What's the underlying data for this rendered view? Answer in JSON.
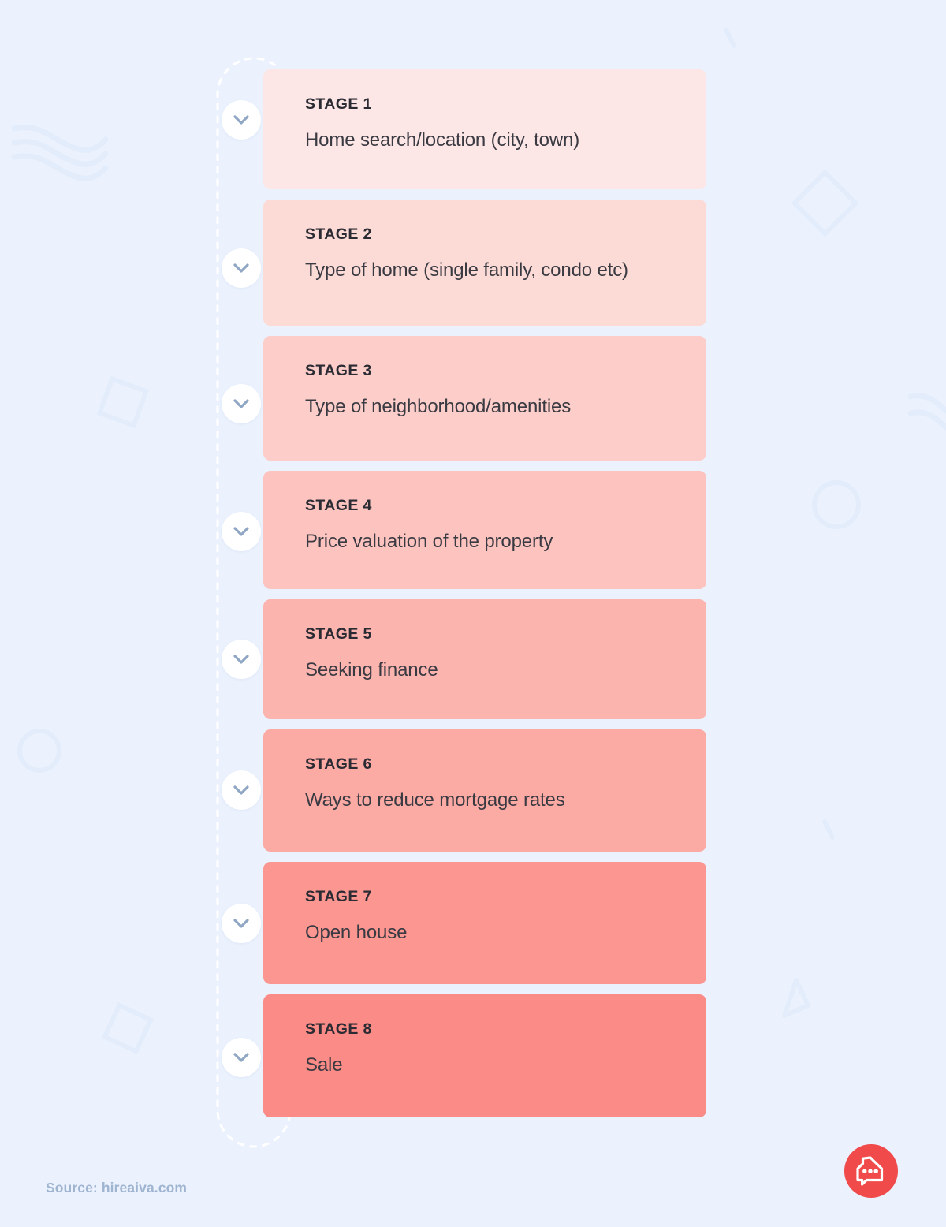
{
  "background": {
    "color": "#EBF2FE",
    "decor_color": "#E2EBFA"
  },
  "stages": [
    {
      "label": "STAGE 1",
      "text": "Home search/location (city, town)",
      "color": "#FDE6E6",
      "chevron_icon": "chevron-down-icon"
    },
    {
      "label": "STAGE 2",
      "text": "Type of home (single family, condo etc)",
      "color": "#FCDAD6",
      "chevron_icon": "chevron-down-icon"
    },
    {
      "label": "STAGE 3",
      "text": "Type of neighborhood/amenities",
      "color": "#FCCDC9",
      "chevron_icon": "chevron-down-icon"
    },
    {
      "label": "STAGE 4",
      "text": "Price valuation of the property",
      "color": "#FCC3BF",
      "chevron_icon": "chevron-down-icon"
    },
    {
      "label": "STAGE 5",
      "text": "Seeking finance",
      "color": "#FCB4AF",
      "chevron_icon": "chevron-down-icon"
    },
    {
      "label": "STAGE 6",
      "text": "Ways to reduce mortgage rates",
      "color": "#FCAAA4",
      "chevron_icon": "chevron-down-icon"
    },
    {
      "label": "STAGE 7",
      "text": "Open house",
      "color": "#FB9691",
      "chevron_icon": "chevron-down-icon"
    },
    {
      "label": "STAGE 8",
      "text": "Sale",
      "color": "#FA8B86",
      "chevron_icon": "chevron-down-icon"
    }
  ],
  "footer": {
    "source": "Source: hireaiva.com"
  },
  "brand": {
    "icon": "house-chat-bubble-icon",
    "color": "#F04A4A"
  }
}
